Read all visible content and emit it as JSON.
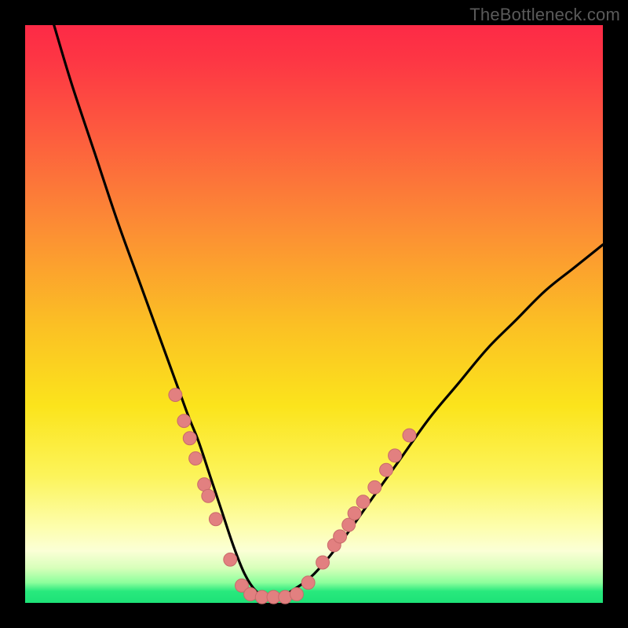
{
  "watermark": "TheBottleneck.com",
  "colors": {
    "curve": "#000000",
    "dot_fill": "#e28080",
    "dot_stroke": "#c96a6a",
    "stage_bg": "#000000"
  },
  "chart_data": {
    "type": "line",
    "title": "",
    "xlabel": "",
    "ylabel": "",
    "xlim": [
      0,
      100
    ],
    "ylim": [
      0,
      100
    ],
    "grid": false,
    "legend": false,
    "note": "Axes unlabeled; values are estimated from pixel positions on a 0–100 normalized grid where (0,0) is bottom-left.",
    "series": [
      {
        "name": "bottleneck-curve",
        "x": [
          5,
          8,
          12,
          16,
          20,
          24,
          28,
          30,
          32,
          34,
          36,
          38,
          40,
          42,
          44,
          46,
          50,
          55,
          60,
          65,
          70,
          75,
          80,
          85,
          90,
          95,
          100
        ],
        "y": [
          100,
          90,
          78,
          66,
          55,
          44,
          33,
          28,
          22,
          16,
          10,
          5,
          2,
          1,
          1,
          2,
          5,
          11,
          18,
          25,
          32,
          38,
          44,
          49,
          54,
          58,
          62
        ]
      }
    ],
    "markers": [
      {
        "series": "left-branch",
        "x": 26.0,
        "y": 36.0
      },
      {
        "series": "left-branch",
        "x": 27.5,
        "y": 31.5
      },
      {
        "series": "left-branch",
        "x": 28.5,
        "y": 28.5
      },
      {
        "series": "left-branch",
        "x": 29.5,
        "y": 25.0
      },
      {
        "series": "left-branch",
        "x": 31.0,
        "y": 20.5
      },
      {
        "series": "left-branch",
        "x": 31.7,
        "y": 18.5
      },
      {
        "series": "left-branch",
        "x": 33.0,
        "y": 14.5
      },
      {
        "series": "left-branch",
        "x": 35.5,
        "y": 7.5
      },
      {
        "series": "floor",
        "x": 37.5,
        "y": 3.0
      },
      {
        "series": "floor",
        "x": 39.0,
        "y": 1.5
      },
      {
        "series": "floor",
        "x": 41.0,
        "y": 1.0
      },
      {
        "series": "floor",
        "x": 43.0,
        "y": 1.0
      },
      {
        "series": "floor",
        "x": 45.0,
        "y": 1.0
      },
      {
        "series": "floor",
        "x": 47.0,
        "y": 1.5
      },
      {
        "series": "floor",
        "x": 49.0,
        "y": 3.5
      },
      {
        "series": "right-branch",
        "x": 51.5,
        "y": 7.0
      },
      {
        "series": "right-branch",
        "x": 53.5,
        "y": 10.0
      },
      {
        "series": "right-branch",
        "x": 54.5,
        "y": 11.5
      },
      {
        "series": "right-branch",
        "x": 56.0,
        "y": 13.5
      },
      {
        "series": "right-branch",
        "x": 58.5,
        "y": 17.5
      },
      {
        "series": "right-branch",
        "x": 57.0,
        "y": 15.5
      },
      {
        "series": "right-branch",
        "x": 60.5,
        "y": 20.0
      },
      {
        "series": "right-branch",
        "x": 62.5,
        "y": 23.0
      },
      {
        "series": "right-branch",
        "x": 64.0,
        "y": 25.5
      },
      {
        "series": "right-branch",
        "x": 66.5,
        "y": 29.0
      }
    ],
    "marker_radius_pct": 1.15
  }
}
